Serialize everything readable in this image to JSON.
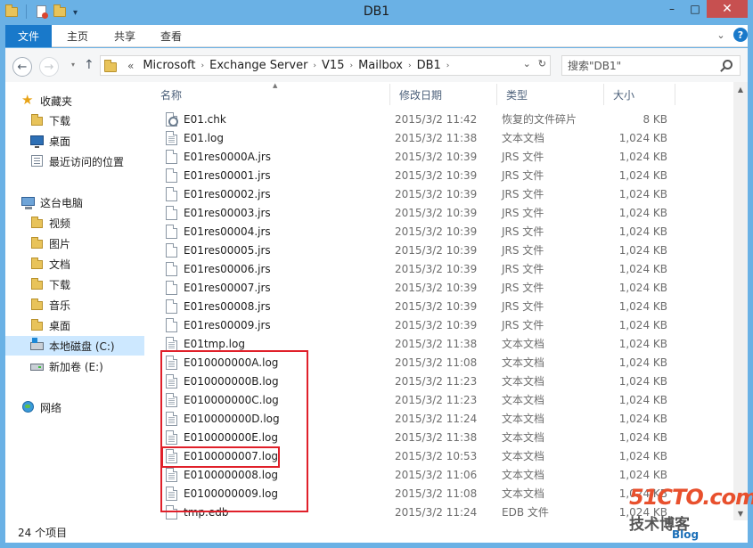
{
  "window": {
    "title": "DB1",
    "minimize_label": "–",
    "maximize_label": "□",
    "close_label": "✕"
  },
  "ribbon": {
    "file_tab": "文件",
    "tabs": [
      "主页",
      "共享",
      "查看"
    ],
    "expand_label": "⌄",
    "help_label": "?"
  },
  "address": {
    "lead": "«",
    "crumbs": [
      "Microsoft",
      "Exchange Server",
      "V15",
      "Mailbox",
      "DB1"
    ],
    "dropdown_label": "⌄",
    "refresh_label": "↻"
  },
  "search": {
    "placeholder": "搜索\"DB1\""
  },
  "sidebar": {
    "favorites": {
      "label": "收藏夹",
      "items": [
        "下载",
        "桌面",
        "最近访问的位置"
      ]
    },
    "this_pc": {
      "label": "这台电脑",
      "items": [
        "视频",
        "图片",
        "文档",
        "下载",
        "音乐",
        "桌面",
        "本地磁盘 (C:)",
        "新加卷 (E:)"
      ]
    },
    "network": {
      "label": "网络"
    }
  },
  "columns": {
    "name": "名称",
    "date": "修改日期",
    "type": "类型",
    "size": "大小"
  },
  "files": [
    {
      "name": "E01.chk",
      "date": "2015/3/2 11:42",
      "type": "恢复的文件碎片",
      "size": "8 KB",
      "icon": "gear"
    },
    {
      "name": "E01.log",
      "date": "2015/3/2 11:38",
      "type": "文本文档",
      "size": "1,024 KB",
      "icon": "lines"
    },
    {
      "name": "E01res0000A.jrs",
      "date": "2015/3/2 10:39",
      "type": "JRS 文件",
      "size": "1,024 KB",
      "icon": "blank"
    },
    {
      "name": "E01res00001.jrs",
      "date": "2015/3/2 10:39",
      "type": "JRS 文件",
      "size": "1,024 KB",
      "icon": "blank"
    },
    {
      "name": "E01res00002.jrs",
      "date": "2015/3/2 10:39",
      "type": "JRS 文件",
      "size": "1,024 KB",
      "icon": "blank"
    },
    {
      "name": "E01res00003.jrs",
      "date": "2015/3/2 10:39",
      "type": "JRS 文件",
      "size": "1,024 KB",
      "icon": "blank"
    },
    {
      "name": "E01res00004.jrs",
      "date": "2015/3/2 10:39",
      "type": "JRS 文件",
      "size": "1,024 KB",
      "icon": "blank"
    },
    {
      "name": "E01res00005.jrs",
      "date": "2015/3/2 10:39",
      "type": "JRS 文件",
      "size": "1,024 KB",
      "icon": "blank"
    },
    {
      "name": "E01res00006.jrs",
      "date": "2015/3/2 10:39",
      "type": "JRS 文件",
      "size": "1,024 KB",
      "icon": "blank"
    },
    {
      "name": "E01res00007.jrs",
      "date": "2015/3/2 10:39",
      "type": "JRS 文件",
      "size": "1,024 KB",
      "icon": "blank"
    },
    {
      "name": "E01res00008.jrs",
      "date": "2015/3/2 10:39",
      "type": "JRS 文件",
      "size": "1,024 KB",
      "icon": "blank"
    },
    {
      "name": "E01res00009.jrs",
      "date": "2015/3/2 10:39",
      "type": "JRS 文件",
      "size": "1,024 KB",
      "icon": "blank"
    },
    {
      "name": "E01tmp.log",
      "date": "2015/3/2 11:38",
      "type": "文本文档",
      "size": "1,024 KB",
      "icon": "lines"
    },
    {
      "name": "E010000000A.log",
      "date": "2015/3/2 11:08",
      "type": "文本文档",
      "size": "1,024 KB",
      "icon": "lines"
    },
    {
      "name": "E010000000B.log",
      "date": "2015/3/2 11:23",
      "type": "文本文档",
      "size": "1,024 KB",
      "icon": "lines"
    },
    {
      "name": "E010000000C.log",
      "date": "2015/3/2 11:23",
      "type": "文本文档",
      "size": "1,024 KB",
      "icon": "lines"
    },
    {
      "name": "E010000000D.log",
      "date": "2015/3/2 11:24",
      "type": "文本文档",
      "size": "1,024 KB",
      "icon": "lines"
    },
    {
      "name": "E010000000E.log",
      "date": "2015/3/2 11:38",
      "type": "文本文档",
      "size": "1,024 KB",
      "icon": "lines"
    },
    {
      "name": "E0100000007.log",
      "date": "2015/3/2 10:53",
      "type": "文本文档",
      "size": "1,024 KB",
      "icon": "lines"
    },
    {
      "name": "E0100000008.log",
      "date": "2015/3/2 11:06",
      "type": "文本文档",
      "size": "1,024 KB",
      "icon": "lines"
    },
    {
      "name": "E0100000009.log",
      "date": "2015/3/2 11:08",
      "type": "文本文档",
      "size": "1,024 KB",
      "icon": "lines"
    },
    {
      "name": "tmp.edb",
      "date": "2015/3/2 11:24",
      "type": "EDB 文件",
      "size": "1,024 KB",
      "icon": "blank"
    }
  ],
  "status": {
    "item_count": "24 个项目"
  },
  "watermark": {
    "line1": "51CTO.com",
    "line2": "技术博客",
    "line3": "Blog"
  },
  "colors": {
    "titlebar": "#6ab1e5",
    "file_tab": "#1979ca",
    "close_button": "#c75050",
    "selected_nav": "#cde8ff",
    "highlight_box": "#e0202a"
  }
}
